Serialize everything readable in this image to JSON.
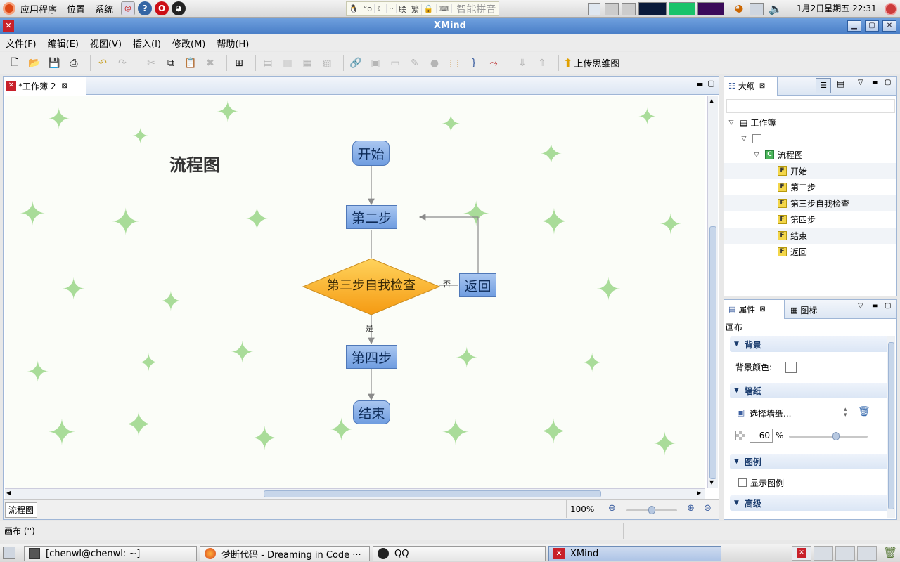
{
  "top_panel": {
    "menus": [
      "应用程序",
      "位置",
      "系统"
    ],
    "ime": {
      "items": [
        "联",
        "繁"
      ],
      "name": "智能拼音"
    },
    "clock": "1月2日星期五 22:31"
  },
  "window": {
    "title": "XMind"
  },
  "menubar": [
    "文件(F)",
    "编辑(E)",
    "视图(V)",
    "插入(I)",
    "修改(M)",
    "帮助(H)"
  ],
  "toolbar": {
    "upload_label": "上传思维图"
  },
  "editor": {
    "tab_label": "*工作簿 2",
    "map_title": "流程图",
    "nodes": {
      "start": "开始",
      "step2": "第二步",
      "step3": "第三步自我检查",
      "back": "返回",
      "step4": "第四步",
      "end": "结束"
    },
    "edge_labels": {
      "no": "否",
      "yes": "是"
    },
    "sheet_tab": "流程图",
    "zoom": "100%",
    "zoom_level": 0.5
  },
  "outline": {
    "tab_label": "大纲",
    "root": "工作簿",
    "central": "流程图",
    "items": [
      "开始",
      "第二步",
      "第三步自我检查",
      "第四步",
      "结束",
      "返回"
    ]
  },
  "properties": {
    "tab_label": "属性",
    "tab2_label": "图标",
    "context": "画布",
    "sections": {
      "background": "背景",
      "wallpaper": "墙纸",
      "legend": "图例",
      "advanced": "高级"
    },
    "bg_color_label": "背景颜色:",
    "choose_wallpaper": "选择墙纸...",
    "opacity_value": "60",
    "opacity_unit": "%",
    "opacity_level": 0.6,
    "show_legend": "显示图例"
  },
  "statusbar": {
    "text": "画布 ('')"
  },
  "taskbar": {
    "tasks": [
      "[chenwl@chenwl: ~]",
      "梦断代码 - Dreaming in Code ···",
      "QQ",
      "XMind"
    ]
  },
  "colors": {
    "titlebar": "#4a7fc8",
    "node_blue": "#6f9de0",
    "decision_orange": "#f7a82a",
    "leaf_green": "#8ed27a"
  }
}
